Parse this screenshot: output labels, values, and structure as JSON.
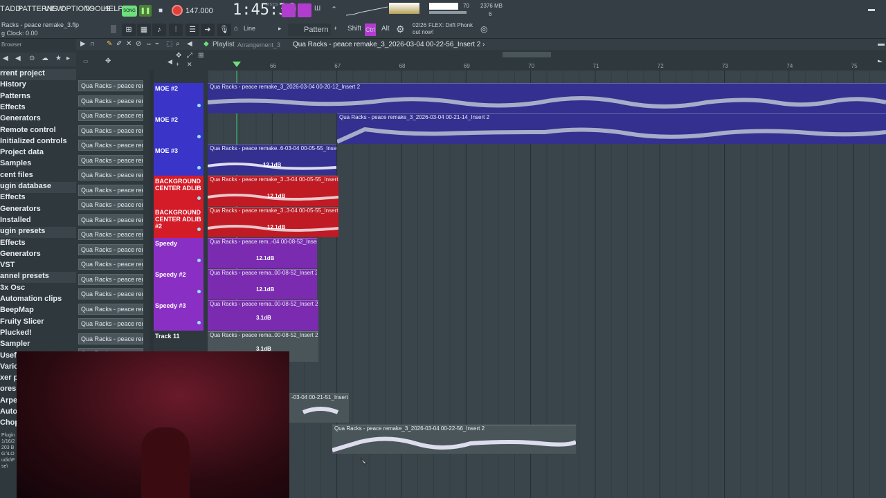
{
  "menu": {
    "file": "T",
    "add": "ADD",
    "patterns": "PATTERNS",
    "view": "VIEW",
    "options": "OPTIONS",
    "tools": "TOOLS",
    "help": "HELP"
  },
  "transport": {
    "mode": "SONG",
    "tempo": "147.000",
    "time": "1:45:30",
    "time_label": "M:S:CS",
    "cpu": "70",
    "memory": "2376 MB",
    "voices": "6"
  },
  "project": {
    "file_title": "Racks - peace remake_3.flp",
    "clock": "g Clock: 0.00"
  },
  "toolbar2": {
    "snap": "Line",
    "pattern": "Pattern 1",
    "shift": "Shift",
    "ctrl": "Ctrl",
    "alt": "Alt",
    "news_date": "02/26",
    "news_line1": "FLEX: Drift Phonk",
    "news_line2": "out now!"
  },
  "playlist": {
    "title": "Playlist",
    "arrangement": "Arrangement_3",
    "crumb": "Qua Racks - peace remake_3_2026-03-04 00-22-56_Insert 2 ›"
  },
  "browser": {
    "title": "Browser",
    "items": [
      "rrent project",
      "History",
      "Patterns",
      "Effects",
      "Generators",
      "Remote control",
      "Initialized controls",
      "Project data",
      "Samples",
      "cent files",
      "ugin database",
      "Effects",
      "Generators",
      "Installed",
      "ugin presets",
      "Effects",
      "Generators",
      "VST",
      "annel presets",
      "3x Osc",
      "Automation clips",
      "BeepMap",
      "Fruity Slicer",
      "Plucked!",
      "Sampler",
      "Usefu",
      "Vario",
      "xer p",
      "ores",
      "Arpeg",
      "Autom",
      "Chopp"
    ]
  },
  "files": {
    "label": "Qua Racks - peace remak"
  },
  "ruler": [
    "66",
    "67",
    "68",
    "69",
    "70",
    "71",
    "72",
    "73",
    "74",
    "75"
  ],
  "tracks": [
    {
      "name": "MOE #2",
      "color": "#3a35c8"
    },
    {
      "name": "MOE #2",
      "color": "#3a35c8"
    },
    {
      "name": "MOE #3",
      "color": "#3a35c8"
    },
    {
      "name": "BACKGROUND CENTER ADLIB",
      "color": "#d41c28"
    },
    {
      "name": "BACKGROUND CENTER ADLIB #2",
      "color": "#d41c28"
    },
    {
      "name": "Speedy",
      "color": "#8a2fc4"
    },
    {
      "name": "Speedy #2",
      "color": "#8a2fc4"
    },
    {
      "name": "Speedy #3",
      "color": "#8a2fc4"
    },
    {
      "name": "Track 11",
      "color": "#2f383d"
    }
  ],
  "clips": {
    "c1": "Qua Racks - peace remake_3_2026-03-04 00-20-12_Insert 2",
    "c2": "Qua Racks - peace remake_3_2026-03-04 00-21-14_Insert 2",
    "c3": "Qua Racks - peace remake..6-03-04 00-05-55_Insert 2",
    "c4": "Qua Racks - peace remake_3..3-04 00-05-55_Insert 2 #2",
    "c5": "Qua Racks - peace remake_3..3-04 00-05-55_Insert 2 #3",
    "c6": "Qua Racks - peace rem..-04 00-08-52_Insert 2",
    "c7": "Qua Racks - peace rema..00-08-52_Insert 2 #2",
    "c8": "Qua Racks - peace rema..00-08-52_Insert 2 #3",
    "c9": "Qua Racks - peace rema..00-08-52_Insert 2 #4",
    "c10": "-03-04 00-21-51_Insert 2",
    "c11": "Qua Racks - peace remake_3_2026-03-04 00-22-56_Insert 2",
    "db1": "12.1dB",
    "db2": "12.1dB",
    "db3": "12.1dB",
    "db4": "12.1dB",
    "db5": "12.1dB",
    "db6": "3.1dB",
    "db7": "3.1dB"
  },
  "bottom_info": [
    "Plugin",
    "1/16/2",
    "203 B",
    "G:\\LO",
    "udio\\F",
    "se\\"
  ],
  "colors": {
    "accent_green": "#6ee07a",
    "record_red": "#e0403a",
    "blue_track": "#3a35c8",
    "red_track": "#d41c28",
    "purple_track": "#8a2fc4"
  }
}
